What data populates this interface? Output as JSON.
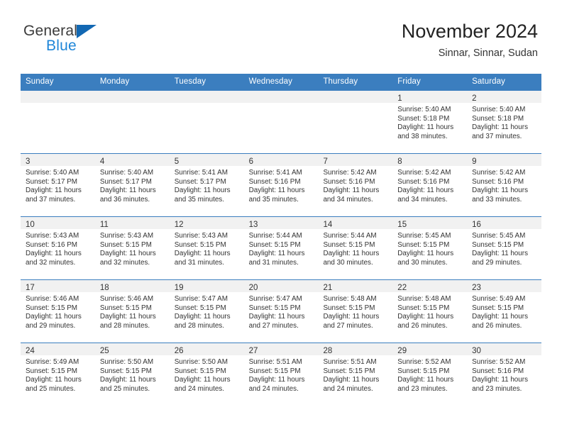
{
  "brand": {
    "name_part1": "General",
    "name_part2": "Blue",
    "accent_color": "#1f86d8",
    "logo_triangle_color": "#1268b3"
  },
  "header": {
    "title": "November 2024",
    "subtitle": "Sinnar, Sinnar, Sudan"
  },
  "calendar": {
    "header_bg_color": "#3b7ebf",
    "weekdays": [
      "Sunday",
      "Monday",
      "Tuesday",
      "Wednesday",
      "Thursday",
      "Friday",
      "Saturday"
    ],
    "labels": {
      "sunrise": "Sunrise:",
      "sunset": "Sunset:",
      "daylight": "Daylight:"
    },
    "weeks": [
      [
        {
          "day": "",
          "empty": true
        },
        {
          "day": "",
          "empty": true
        },
        {
          "day": "",
          "empty": true
        },
        {
          "day": "",
          "empty": true
        },
        {
          "day": "",
          "empty": true
        },
        {
          "day": "1",
          "sunrise": "Sunrise: 5:40 AM",
          "sunset": "Sunset: 5:18 PM",
          "daylight_l1": "Daylight: 11 hours",
          "daylight_l2": "and 38 minutes."
        },
        {
          "day": "2",
          "sunrise": "Sunrise: 5:40 AM",
          "sunset": "Sunset: 5:18 PM",
          "daylight_l1": "Daylight: 11 hours",
          "daylight_l2": "and 37 minutes."
        }
      ],
      [
        {
          "day": "3",
          "sunrise": "Sunrise: 5:40 AM",
          "sunset": "Sunset: 5:17 PM",
          "daylight_l1": "Daylight: 11 hours",
          "daylight_l2": "and 37 minutes."
        },
        {
          "day": "4",
          "sunrise": "Sunrise: 5:40 AM",
          "sunset": "Sunset: 5:17 PM",
          "daylight_l1": "Daylight: 11 hours",
          "daylight_l2": "and 36 minutes."
        },
        {
          "day": "5",
          "sunrise": "Sunrise: 5:41 AM",
          "sunset": "Sunset: 5:17 PM",
          "daylight_l1": "Daylight: 11 hours",
          "daylight_l2": "and 35 minutes."
        },
        {
          "day": "6",
          "sunrise": "Sunrise: 5:41 AM",
          "sunset": "Sunset: 5:16 PM",
          "daylight_l1": "Daylight: 11 hours",
          "daylight_l2": "and 35 minutes."
        },
        {
          "day": "7",
          "sunrise": "Sunrise: 5:42 AM",
          "sunset": "Sunset: 5:16 PM",
          "daylight_l1": "Daylight: 11 hours",
          "daylight_l2": "and 34 minutes."
        },
        {
          "day": "8",
          "sunrise": "Sunrise: 5:42 AM",
          "sunset": "Sunset: 5:16 PM",
          "daylight_l1": "Daylight: 11 hours",
          "daylight_l2": "and 34 minutes."
        },
        {
          "day": "9",
          "sunrise": "Sunrise: 5:42 AM",
          "sunset": "Sunset: 5:16 PM",
          "daylight_l1": "Daylight: 11 hours",
          "daylight_l2": "and 33 minutes."
        }
      ],
      [
        {
          "day": "10",
          "sunrise": "Sunrise: 5:43 AM",
          "sunset": "Sunset: 5:16 PM",
          "daylight_l1": "Daylight: 11 hours",
          "daylight_l2": "and 32 minutes."
        },
        {
          "day": "11",
          "sunrise": "Sunrise: 5:43 AM",
          "sunset": "Sunset: 5:15 PM",
          "daylight_l1": "Daylight: 11 hours",
          "daylight_l2": "and 32 minutes."
        },
        {
          "day": "12",
          "sunrise": "Sunrise: 5:43 AM",
          "sunset": "Sunset: 5:15 PM",
          "daylight_l1": "Daylight: 11 hours",
          "daylight_l2": "and 31 minutes."
        },
        {
          "day": "13",
          "sunrise": "Sunrise: 5:44 AM",
          "sunset": "Sunset: 5:15 PM",
          "daylight_l1": "Daylight: 11 hours",
          "daylight_l2": "and 31 minutes."
        },
        {
          "day": "14",
          "sunrise": "Sunrise: 5:44 AM",
          "sunset": "Sunset: 5:15 PM",
          "daylight_l1": "Daylight: 11 hours",
          "daylight_l2": "and 30 minutes."
        },
        {
          "day": "15",
          "sunrise": "Sunrise: 5:45 AM",
          "sunset": "Sunset: 5:15 PM",
          "daylight_l1": "Daylight: 11 hours",
          "daylight_l2": "and 30 minutes."
        },
        {
          "day": "16",
          "sunrise": "Sunrise: 5:45 AM",
          "sunset": "Sunset: 5:15 PM",
          "daylight_l1": "Daylight: 11 hours",
          "daylight_l2": "and 29 minutes."
        }
      ],
      [
        {
          "day": "17",
          "sunrise": "Sunrise: 5:46 AM",
          "sunset": "Sunset: 5:15 PM",
          "daylight_l1": "Daylight: 11 hours",
          "daylight_l2": "and 29 minutes."
        },
        {
          "day": "18",
          "sunrise": "Sunrise: 5:46 AM",
          "sunset": "Sunset: 5:15 PM",
          "daylight_l1": "Daylight: 11 hours",
          "daylight_l2": "and 28 minutes."
        },
        {
          "day": "19",
          "sunrise": "Sunrise: 5:47 AM",
          "sunset": "Sunset: 5:15 PM",
          "daylight_l1": "Daylight: 11 hours",
          "daylight_l2": "and 28 minutes."
        },
        {
          "day": "20",
          "sunrise": "Sunrise: 5:47 AM",
          "sunset": "Sunset: 5:15 PM",
          "daylight_l1": "Daylight: 11 hours",
          "daylight_l2": "and 27 minutes."
        },
        {
          "day": "21",
          "sunrise": "Sunrise: 5:48 AM",
          "sunset": "Sunset: 5:15 PM",
          "daylight_l1": "Daylight: 11 hours",
          "daylight_l2": "and 27 minutes."
        },
        {
          "day": "22",
          "sunrise": "Sunrise: 5:48 AM",
          "sunset": "Sunset: 5:15 PM",
          "daylight_l1": "Daylight: 11 hours",
          "daylight_l2": "and 26 minutes."
        },
        {
          "day": "23",
          "sunrise": "Sunrise: 5:49 AM",
          "sunset": "Sunset: 5:15 PM",
          "daylight_l1": "Daylight: 11 hours",
          "daylight_l2": "and 26 minutes."
        }
      ],
      [
        {
          "day": "24",
          "sunrise": "Sunrise: 5:49 AM",
          "sunset": "Sunset: 5:15 PM",
          "daylight_l1": "Daylight: 11 hours",
          "daylight_l2": "and 25 minutes."
        },
        {
          "day": "25",
          "sunrise": "Sunrise: 5:50 AM",
          "sunset": "Sunset: 5:15 PM",
          "daylight_l1": "Daylight: 11 hours",
          "daylight_l2": "and 25 minutes."
        },
        {
          "day": "26",
          "sunrise": "Sunrise: 5:50 AM",
          "sunset": "Sunset: 5:15 PM",
          "daylight_l1": "Daylight: 11 hours",
          "daylight_l2": "and 24 minutes."
        },
        {
          "day": "27",
          "sunrise": "Sunrise: 5:51 AM",
          "sunset": "Sunset: 5:15 PM",
          "daylight_l1": "Daylight: 11 hours",
          "daylight_l2": "and 24 minutes."
        },
        {
          "day": "28",
          "sunrise": "Sunrise: 5:51 AM",
          "sunset": "Sunset: 5:15 PM",
          "daylight_l1": "Daylight: 11 hours",
          "daylight_l2": "and 24 minutes."
        },
        {
          "day": "29",
          "sunrise": "Sunrise: 5:52 AM",
          "sunset": "Sunset: 5:15 PM",
          "daylight_l1": "Daylight: 11 hours",
          "daylight_l2": "and 23 minutes."
        },
        {
          "day": "30",
          "sunrise": "Sunrise: 5:52 AM",
          "sunset": "Sunset: 5:16 PM",
          "daylight_l1": "Daylight: 11 hours",
          "daylight_l2": "and 23 minutes."
        }
      ]
    ]
  }
}
